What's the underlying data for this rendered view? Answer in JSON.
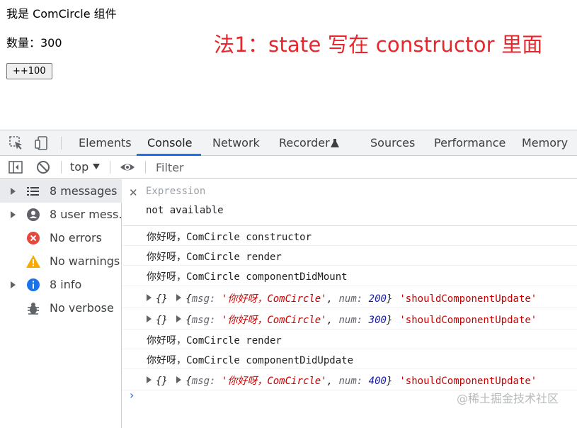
{
  "app": {
    "component_title": "我是 ComCircle 组件",
    "count_text": "数量：300",
    "increment_button": "++100",
    "annotation": "法1：state 写在 constructor 里面"
  },
  "devtools": {
    "tabs": [
      {
        "label": "Elements",
        "active": false
      },
      {
        "label": "Console",
        "active": true
      },
      {
        "label": "Network",
        "active": false
      },
      {
        "label": "Recorder",
        "active": false
      },
      {
        "label": "Sources",
        "active": false
      },
      {
        "label": "Performance",
        "active": false
      },
      {
        "label": "Memory",
        "active": false
      }
    ],
    "toolbar": {
      "context": "top",
      "filter_placeholder": "Filter"
    },
    "sidebar": [
      {
        "label": "8 messages",
        "icon": "list-icon",
        "selected": true
      },
      {
        "label": "8 user mess…",
        "icon": "user-icon",
        "selected": false
      },
      {
        "label": "No errors",
        "icon": "error-icon",
        "selected": false
      },
      {
        "label": "No warnings",
        "icon": "warning-icon",
        "selected": false
      },
      {
        "label": "8 info",
        "icon": "info-icon",
        "selected": false
      },
      {
        "label": "No verbose",
        "icon": "bug-icon",
        "selected": false
      }
    ],
    "expression": {
      "label": "Expression",
      "value": "not available"
    },
    "logs": [
      {
        "text": "你好呀，ComCircle constructor"
      },
      {
        "text": "你好呀，ComCircle render"
      },
      {
        "text": "你好呀，ComCircle componentDidMount"
      },
      {
        "obj": {
          "brace": "{}",
          "msg_key": "msg:",
          "msg": "'你好呀，ComCircle'",
          "num_key": "num:",
          "num": "200"
        },
        "tag": "'shouldComponentUpdate'"
      },
      {
        "obj": {
          "brace": "{}",
          "msg_key": "msg:",
          "msg": "'你好呀，ComCircle'",
          "num_key": "num:",
          "num": "300"
        },
        "tag": "'shouldComponentUpdate'"
      },
      {
        "text": "你好呀，ComCircle render"
      },
      {
        "text": "你好呀，ComCircle componentDidUpdate"
      },
      {
        "obj": {
          "brace": "{}",
          "msg_key": "msg:",
          "msg": "'你好呀，ComCircle'",
          "num_key": "num:",
          "num": "400"
        },
        "tag": "'shouldComponentUpdate'"
      }
    ],
    "prompt": "›"
  },
  "watermark": "@稀土掘金技术社区",
  "colors": {
    "accent": "#1a73e8",
    "annotation_red": "#e8262b",
    "string_red": "#c80000",
    "number_blue": "#1a1aa6"
  }
}
